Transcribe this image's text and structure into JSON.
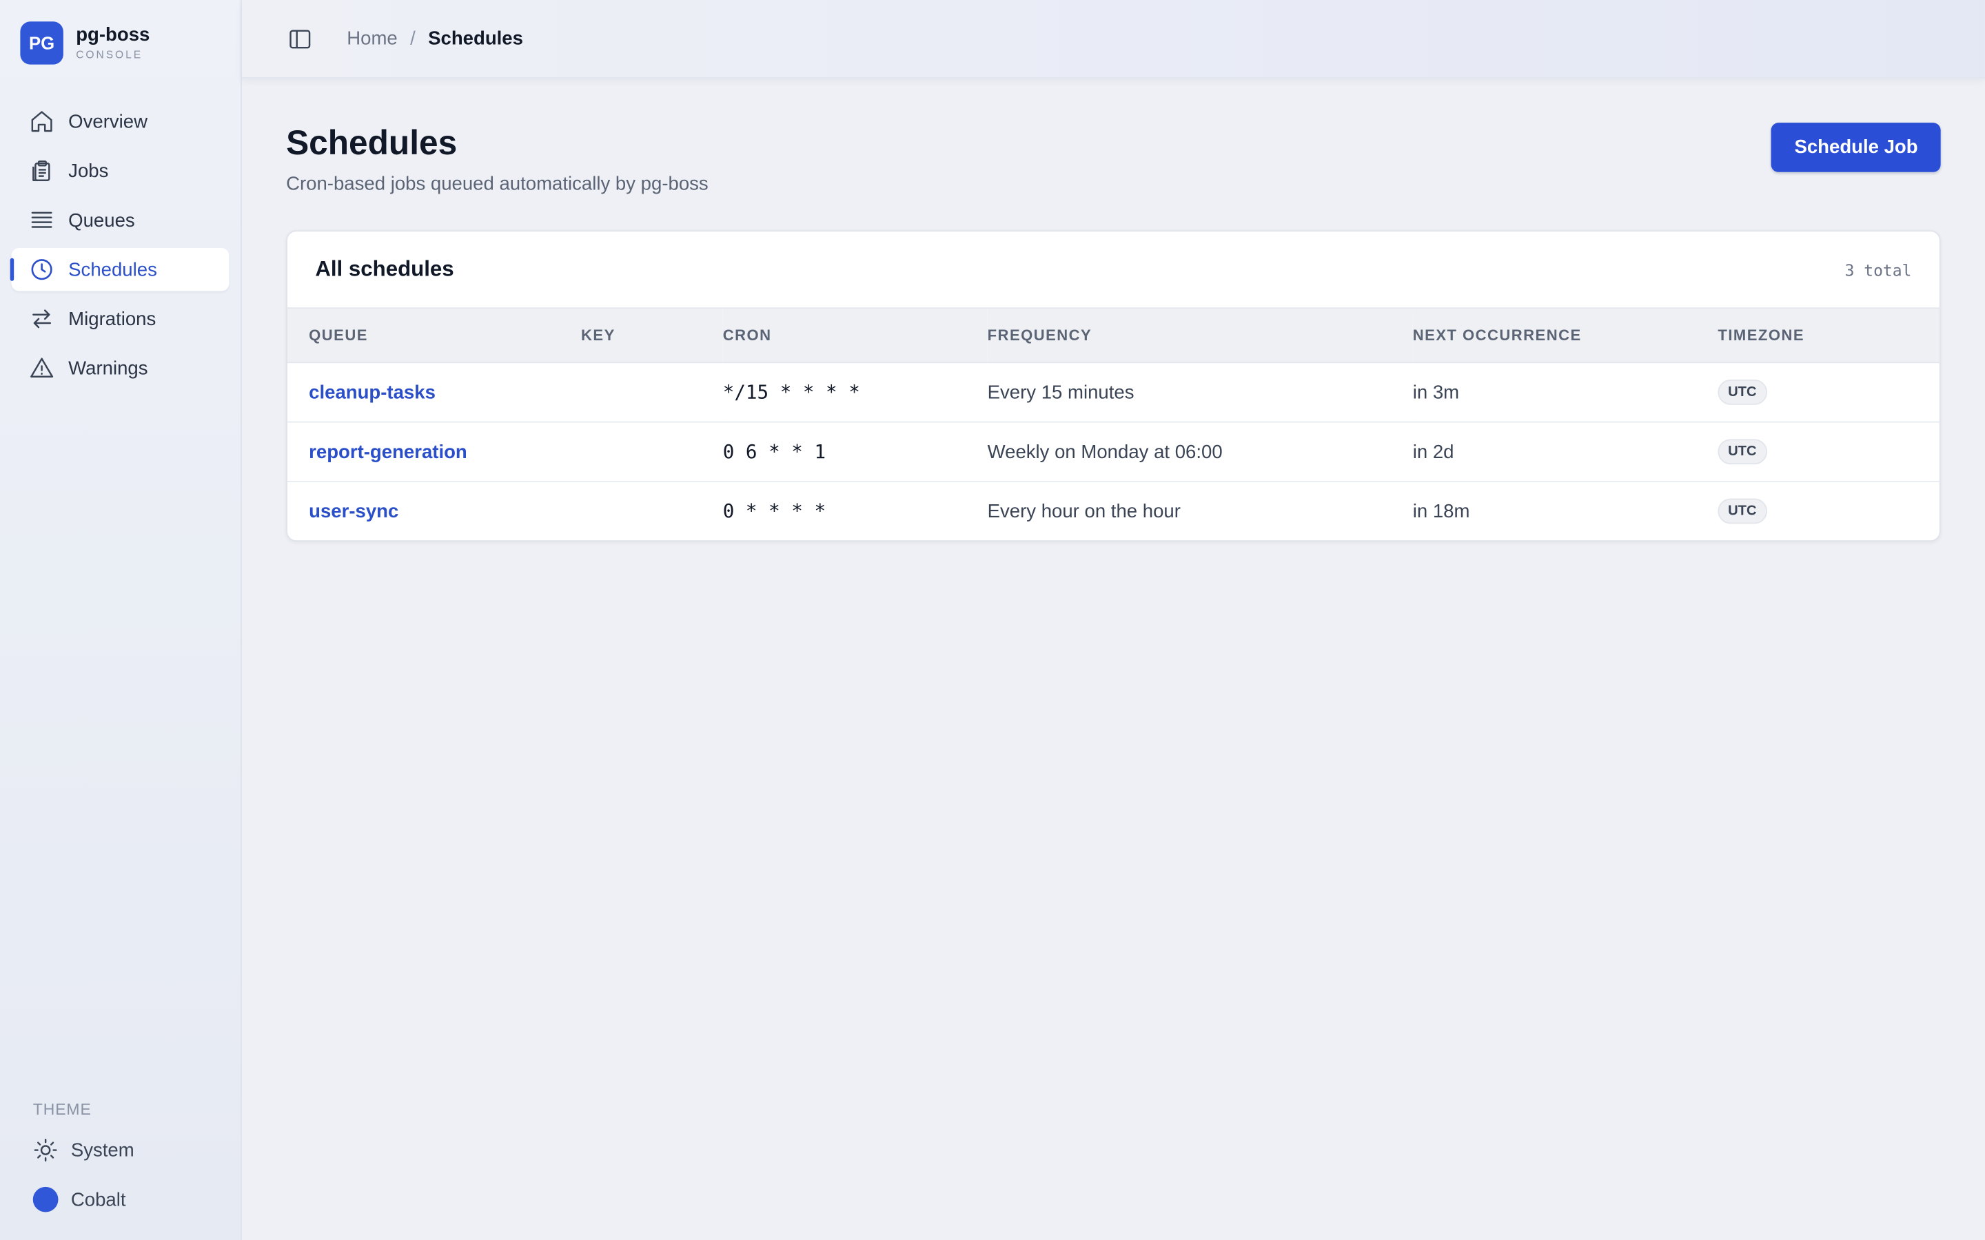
{
  "brand": {
    "logo": "PG",
    "name": "pg-boss",
    "subtitle": "CONSOLE"
  },
  "sidebar": {
    "items": [
      {
        "label": "Overview",
        "icon": "home-icon"
      },
      {
        "label": "Jobs",
        "icon": "clipboard-icon"
      },
      {
        "label": "Queues",
        "icon": "list-icon"
      },
      {
        "label": "Schedules",
        "icon": "clock-icon",
        "active": true
      },
      {
        "label": "Migrations",
        "icon": "arrows-icon"
      },
      {
        "label": "Warnings",
        "icon": "warning-icon"
      }
    ],
    "theme": {
      "label": "THEME",
      "mode": "System",
      "color": "Cobalt",
      "swatch": "#2f57d8"
    }
  },
  "topbar": {
    "breadcrumb": {
      "home": "Home",
      "separator": "/",
      "current": "Schedules"
    }
  },
  "page": {
    "title": "Schedules",
    "subtitle": "Cron-based jobs queued automatically by pg-boss",
    "primary_button": "Schedule Job"
  },
  "card": {
    "title": "All schedules",
    "count": "3 total",
    "columns": [
      "QUEUE",
      "KEY",
      "CRON",
      "FREQUENCY",
      "NEXT OCCURRENCE",
      "TIMEZONE"
    ],
    "rows": [
      {
        "queue": "cleanup-tasks",
        "key": "",
        "cron": "*/15 * * * *",
        "frequency": "Every 15 minutes",
        "next": "in 3m",
        "tz": "UTC"
      },
      {
        "queue": "report-generation",
        "key": "",
        "cron": "0 6 * * 1",
        "frequency": "Weekly on Monday at 06:00",
        "next": "in 2d",
        "tz": "UTC"
      },
      {
        "queue": "user-sync",
        "key": "",
        "cron": "0 * * * *",
        "frequency": "Every hour on the hour",
        "next": "in 18m",
        "tz": "UTC"
      }
    ]
  },
  "colors": {
    "accent": "#2a4fd6",
    "link": "#2a4fc9",
    "background": "#eef0f5"
  }
}
